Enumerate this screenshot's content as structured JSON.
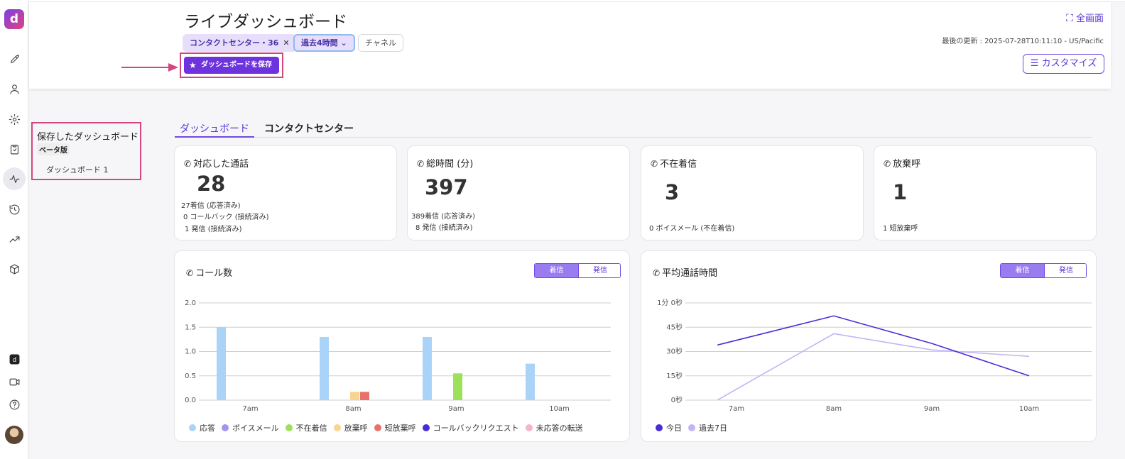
{
  "header": {
    "title": "ライブダッシュボード",
    "fullscreen_label": "全画面",
    "updated_label": "最後の更新 : 2025-07-28T10:11:10 - US/Pacific",
    "customize_label": "カスタマイズ",
    "filters": {
      "contact_center": "コンタクトセンター・36",
      "period": "過去4時間",
      "channel": "チャネル"
    },
    "save_label": "ダッシュボードを保存"
  },
  "saved_panel": {
    "title": "保存したダッシュボード",
    "badge": "ベータ版",
    "items": [
      "ダッシュボード 1"
    ]
  },
  "tabs": [
    {
      "label": "ダッシュボード",
      "active": true
    },
    {
      "label": "コンタクトセンター",
      "active": false
    }
  ],
  "stats": [
    {
      "title": "対応した通話",
      "value": "28",
      "lines": [
        "27着信 (応答済み)",
        "0 コールバック (接続済み)",
        "1 発信 (接続済み)"
      ]
    },
    {
      "title": "総時間 (分)",
      "value": "397",
      "lines": [
        "389着信 (応答済み)",
        "8  発信 (接続済み)"
      ]
    },
    {
      "title": "不在着信",
      "value": "3",
      "lines": [
        "0 ボイスメール (不在着信)"
      ]
    },
    {
      "title": "放棄呼",
      "value": "1",
      "lines": [
        "1 短放棄呼"
      ]
    }
  ],
  "charts": {
    "calls": {
      "title": "コール数",
      "toggle": [
        "着信",
        "発信"
      ]
    },
    "avg": {
      "title": "平均通話時間",
      "toggle": [
        "着信",
        "発信"
      ]
    }
  },
  "chart_data": [
    {
      "type": "bar",
      "title": "コール数",
      "categories": [
        "7am",
        "8am",
        "9am",
        "10am"
      ],
      "ylim": [
        0,
        2.0
      ],
      "yticks": [
        "0.0",
        "0.5",
        "1.0",
        "1.5",
        "2.0"
      ],
      "legend_position": "bottom",
      "series": [
        {
          "name": "応答",
          "color": "#a9d4f7",
          "values": [
            1.5,
            1.3,
            1.3,
            0.75
          ]
        },
        {
          "name": "ボイスメール",
          "color": "#a793ef",
          "values": [
            0,
            0,
            0,
            0
          ]
        },
        {
          "name": "不在着信",
          "color": "#9de05a",
          "values": [
            0,
            0,
            0.55,
            0
          ]
        },
        {
          "name": "放棄呼",
          "color": "#f8d48e",
          "values": [
            0,
            0.17,
            0,
            0
          ]
        },
        {
          "name": "短放棄呼",
          "color": "#e8716c",
          "values": [
            0,
            0.17,
            0,
            0
          ]
        },
        {
          "name": "コールバックリクエスト",
          "color": "#4b2bd6",
          "values": [
            0,
            0,
            0,
            0
          ]
        },
        {
          "name": "未応答の転送",
          "color": "#f4b4cc",
          "values": [
            0,
            0,
            0,
            0
          ]
        }
      ]
    },
    {
      "type": "line",
      "title": "平均通話時間",
      "categories": [
        "7am",
        "8am",
        "9am",
        "10am"
      ],
      "ylim": [
        0,
        60
      ],
      "yticks": [
        "0秒",
        "15秒",
        "30秒",
        "45秒",
        "1分 0秒"
      ],
      "legend_position": "bottom",
      "series": [
        {
          "name": "今日",
          "color": "#4b2bd6",
          "values": [
            34,
            52,
            35,
            15
          ]
        },
        {
          "name": "過去7日",
          "color": "#c4b4f4",
          "values": [
            0,
            41,
            31,
            27
          ]
        }
      ]
    }
  ]
}
